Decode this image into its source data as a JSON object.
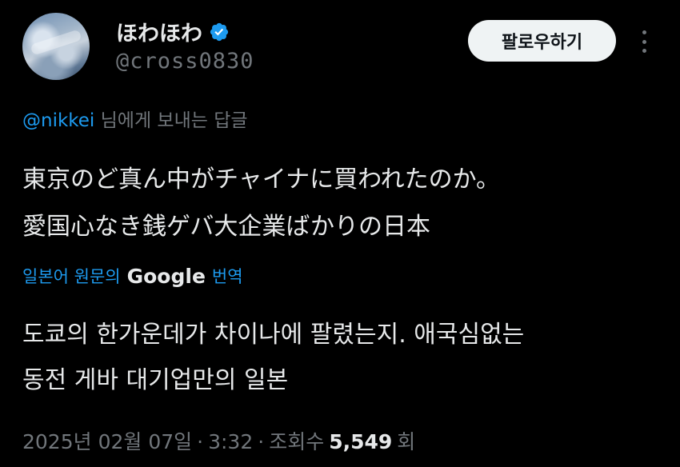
{
  "author": {
    "display_name": "ほわほわ",
    "handle": "@cross0830",
    "verified": true
  },
  "actions": {
    "follow_label": "팔로우하기"
  },
  "reply_to": {
    "mention": "@nikkei",
    "suffix": " 님에게 보내는 답글"
  },
  "tweet": {
    "text": "東京のど真ん中がチャイナに買われたのか。\n愛国心なき銭ゲバ大企業ばかりの日本"
  },
  "translation": {
    "label": "일본어 원문의",
    "provider": "Google",
    "action": "번역",
    "text": "도쿄의 한가운데가 차이나에 팔렸는지. 애국심없는\n동전 게바 대기업만의 일본"
  },
  "meta": {
    "date": "2025년 02월 07일",
    "sep1": "·",
    "time": "3:32",
    "sep2": "·",
    "views_label": "조회수",
    "views_count": "5,549",
    "views_unit": "회"
  },
  "colors": {
    "background": "#000000",
    "text": "#e7e9ea",
    "muted": "#71767b",
    "accent": "#1d9bf0"
  }
}
